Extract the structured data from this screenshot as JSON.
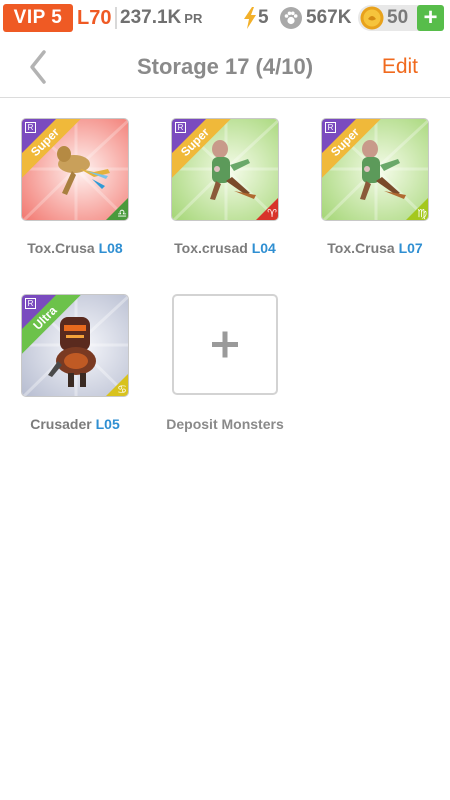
{
  "status": {
    "vip": "VIP 5",
    "level": "L70",
    "power": "237.1K",
    "power_unit": "PR",
    "energy": "5",
    "food": "567K",
    "coins": "50",
    "add_label": "+"
  },
  "nav": {
    "title": "Storage 17 (4/10)",
    "edit": "Edit"
  },
  "monsters": [
    {
      "name": "Tox.Crusa",
      "level": "L08",
      "rarity": "Super",
      "class_badge": "R",
      "bg": "red",
      "zodiac_symbol": "♎"
    },
    {
      "name": "Tox.crusad",
      "level": "L04",
      "rarity": "Super",
      "class_badge": "R",
      "bg": "green",
      "zodiac_symbol": "♈"
    },
    {
      "name": "Tox.Crusa",
      "level": "L07",
      "rarity": "Super",
      "class_badge": "R",
      "bg": "green",
      "zodiac_symbol": "♍"
    },
    {
      "name": "Crusader",
      "level": "L05",
      "rarity": "Ultra",
      "class_badge": "R",
      "bg": "gray",
      "zodiac_symbol": "♋"
    }
  ],
  "deposit": {
    "label": "Deposit Monsters",
    "icon": "+"
  },
  "colors": {
    "accent_orange": "#ef5a24",
    "level_blue": "#2f8fd2",
    "super_ribbon": "#f0b93a",
    "ultra_ribbon": "#6cc24a",
    "class_badge_purple": "#7a4bbf"
  }
}
